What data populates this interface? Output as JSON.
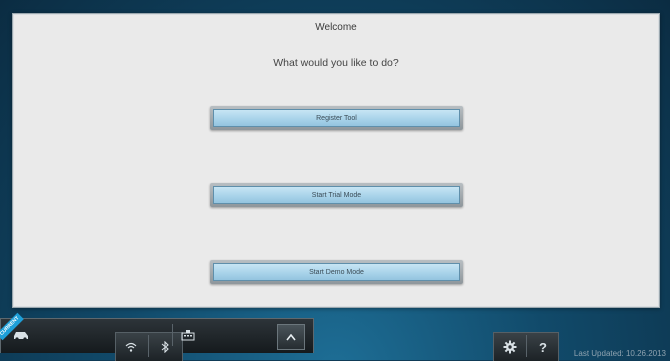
{
  "main": {
    "title": "Welcome",
    "question": "What would you like to do?",
    "buttons": {
      "register": "Register Tool",
      "trial": "Start Trial Mode",
      "demo": "Start Demo Mode"
    }
  },
  "taskbar": {
    "left_icons": [
      "wifi-icon",
      "bluetooth-icon"
    ],
    "center": {
      "badge": "CURRENT",
      "vehicle_icon": "car-icon",
      "tool_icon": "keyboard-icon"
    },
    "up_button": "^",
    "right_icons": [
      "gear-icon",
      "help-icon"
    ],
    "help_label": "?",
    "last_updated": "Last Updated: 10.26.2013"
  },
  "colors": {
    "button_fill": "#a9d3ea",
    "panel": "#eaeaea",
    "background": "#114a6a",
    "badge": "#1e9fd8"
  }
}
